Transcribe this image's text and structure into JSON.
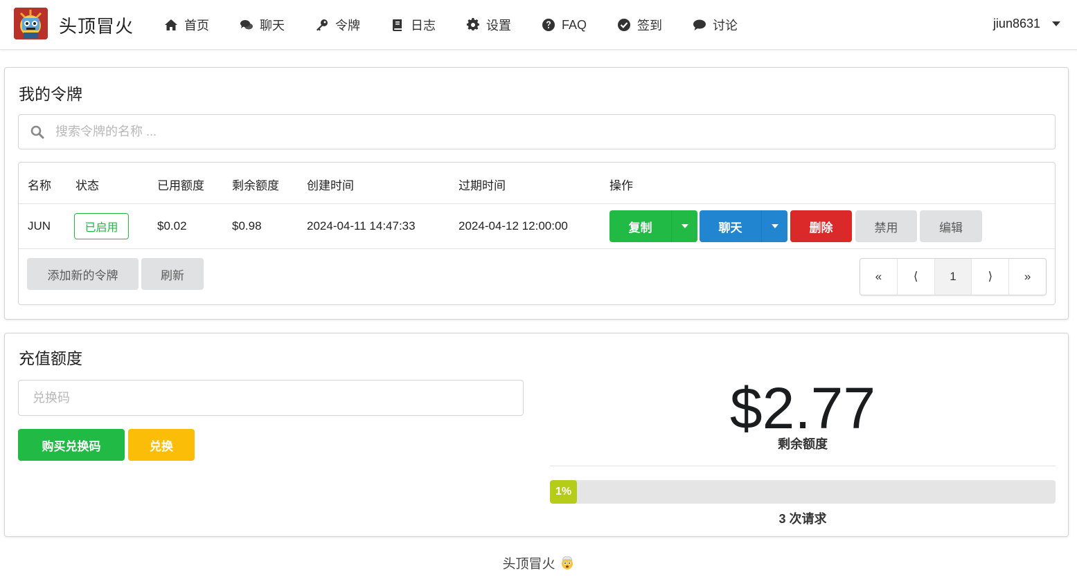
{
  "app": {
    "brand": "头顶冒火",
    "footer_text": "头顶冒火",
    "footer_emoji": "🤯"
  },
  "nav": {
    "items": [
      {
        "label": "首页",
        "icon": "home-icon"
      },
      {
        "label": "聊天",
        "icon": "comments-icon"
      },
      {
        "label": "令牌",
        "icon": "key-icon"
      },
      {
        "label": "日志",
        "icon": "book-icon"
      },
      {
        "label": "设置",
        "icon": "gear-icon"
      },
      {
        "label": "FAQ",
        "icon": "question-circle-icon"
      },
      {
        "label": "签到",
        "icon": "check-circle-icon"
      },
      {
        "label": "讨论",
        "icon": "comment-icon"
      }
    ],
    "user": "jiun8631"
  },
  "tokens": {
    "title": "我的令牌",
    "search_placeholder": "搜索令牌的名称 ...",
    "columns": [
      "名称",
      "状态",
      "已用额度",
      "剩余额度",
      "创建时间",
      "过期时间",
      "操作"
    ],
    "rows": [
      {
        "name": "JUN",
        "status": "已启用",
        "used": "$0.02",
        "remaining": "$0.98",
        "created": "2024-04-11 14:47:33",
        "expires": "2024-04-12 12:00:00",
        "actions": {
          "copy": "复制",
          "chat": "聊天",
          "delete": "删除",
          "disable": "禁用",
          "edit": "编辑"
        }
      }
    ],
    "add_button": "添加新的令牌",
    "refresh_button": "刷新",
    "pagination": {
      "first": "«",
      "prev": "⟨",
      "current": "1",
      "next": "⟩",
      "last": "»"
    }
  },
  "recharge": {
    "title": "充值额度",
    "code_placeholder": "兑换码",
    "buy_button": "购买兑换码",
    "redeem_button": "兑换",
    "balance": "$2.77",
    "balance_label": "剩余额度",
    "progress_percent": 1,
    "progress_label": "1%",
    "requests_label": "3 次请求"
  },
  "colors": {
    "green": "#21ba45",
    "blue": "#2185d0",
    "red": "#db2828",
    "yellow": "#fbbd08",
    "olive": "#b5cc18",
    "grey": "#e0e1e2"
  }
}
